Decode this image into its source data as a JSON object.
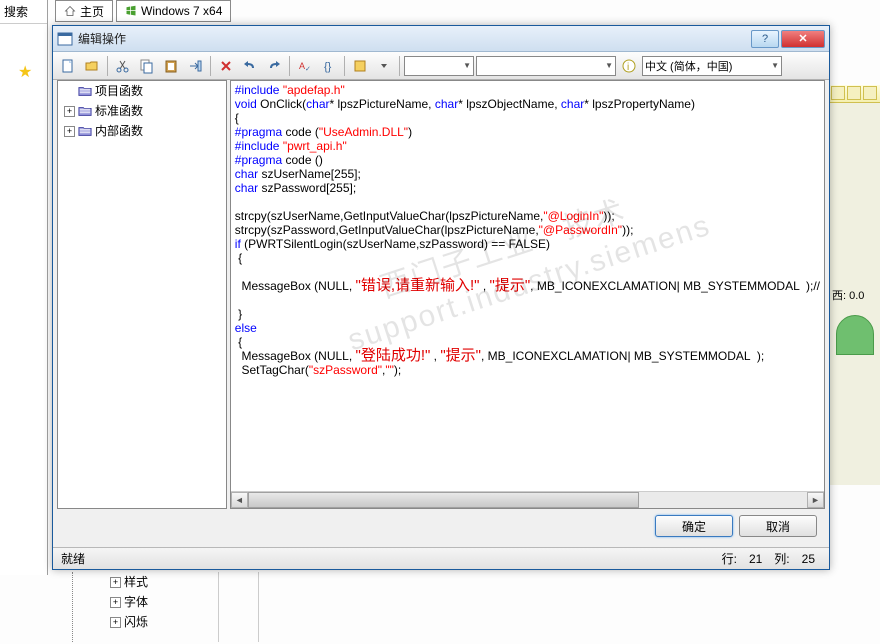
{
  "bg": {
    "home_tab": "主页",
    "win_tab": "Windows 7 x64",
    "search": "搜索",
    "right_label": "西: 0.0",
    "btree": [
      "样式",
      "字体",
      "闪烁"
    ]
  },
  "dialog": {
    "title": "编辑操作",
    "help": "?",
    "close": "✕"
  },
  "toolbar": {
    "combo1": "",
    "combo2": "",
    "lang": "中文 (简体，中国)"
  },
  "tree": {
    "items": [
      {
        "label": "项目函数",
        "exp": "−"
      },
      {
        "label": "标准函数",
        "exp": "+"
      },
      {
        "label": "内部函数",
        "exp": "+"
      }
    ]
  },
  "code": {
    "l1a": "#include ",
    "l1b": "\"apdefap.h\"",
    "l2a": "void",
    "l2b": " OnClick(",
    "l2c": "char",
    "l2d": "* lpszPictureName, ",
    "l2e": "char",
    "l2f": "* lpszObjectName, ",
    "l2g": "char",
    "l2h": "* lpszPropertyName)",
    "l3": "{",
    "l4a": "#pragma",
    "l4b": " code (",
    "l4c": "\"UseAdmin.DLL\"",
    "l4d": ")",
    "l5a": "#include ",
    "l5b": "\"pwrt_api.h\"",
    "l6a": "#pragma",
    "l6b": " code ()",
    "l7a": "char",
    "l7b": " szUserName[255];",
    "l8a": "char",
    "l8b": " szPassword[255];",
    "blank": "",
    "l10a": "strcpy(szUserName,GetInputValueChar(lpszPictureName,",
    "l10b": "\"@LoginIn\"",
    "l10c": "));",
    "l11a": "strcpy(szPassword,GetInputValueChar(lpszPictureName,",
    "l11b": "\"@PasswordIn\"",
    "l11c": "));",
    "l12a": "if",
    "l12b": " (PWRTSilentLogin(szUserName,szPassword) == FALSE)",
    "l13": " {",
    "l15a": "  MessageBox (NULL, ",
    "l15b": "\"错误,请重新输入!\"",
    "l15c": " , ",
    "l15d": "\"提示\"",
    "l15e": ", MB_ICONEXCLAMATION| MB_SYSTEMMODAL  );//",
    "l17": " }",
    "l18": "else",
    "l19": " {",
    "l20a": "  MessageBox (NULL, ",
    "l20b": "\"登陆成功!\"",
    "l20c": " , ",
    "l20d": "\"提示\"",
    "l20e": ", MB_ICONEXCLAMATION| MB_SYSTEMMODAL  );",
    "l21a": "  SetTagChar(",
    "l21b": "\"szPassword\"",
    "l21c": ",",
    "l21d": "\"\"",
    "l21e": ");"
  },
  "buttons": {
    "ok": "确定",
    "cancel": "取消"
  },
  "status": {
    "ready": "就绪",
    "line_lbl": "行:",
    "line_val": "21",
    "col_lbl": "列:",
    "col_val": "25"
  },
  "watermark": "西门子工业　技术\nsupport.industry.siemens"
}
